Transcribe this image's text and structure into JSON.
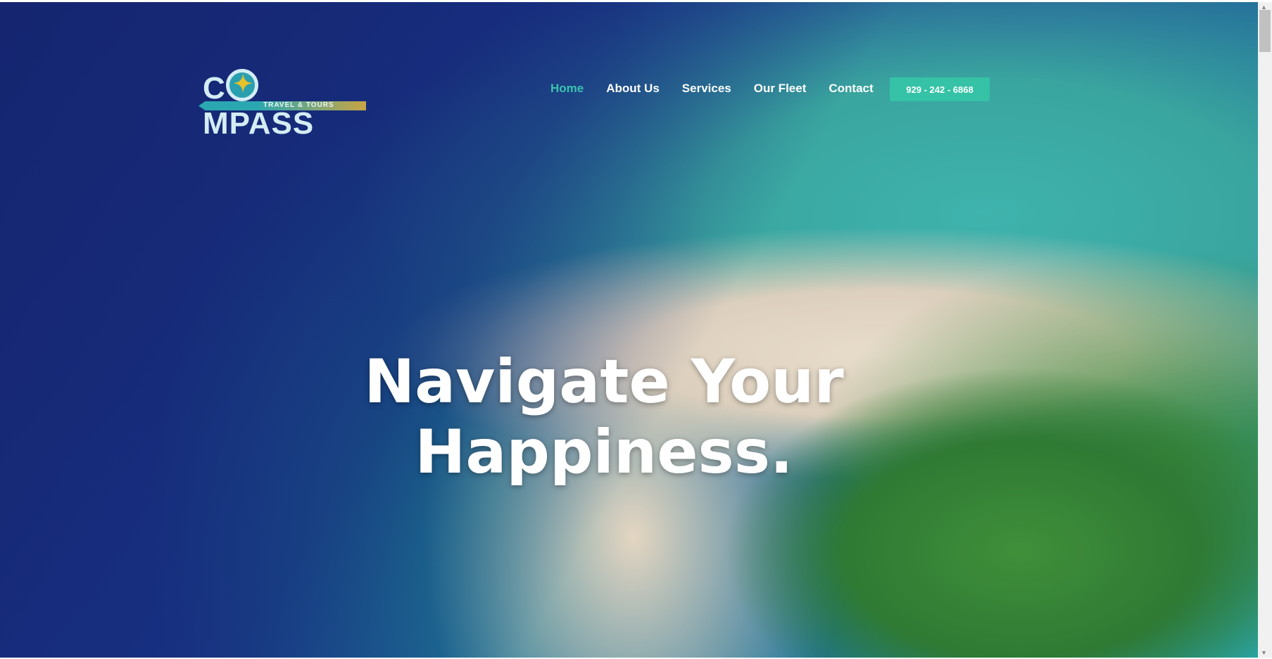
{
  "logo": {
    "word_pre": "C",
    "word_post": "MPASS",
    "tagline": "TRAVEL & TOURS"
  },
  "nav": [
    {
      "label": "Home",
      "active": true
    },
    {
      "label": "About Us"
    },
    {
      "label": "Services"
    },
    {
      "label": "Our Fleet"
    },
    {
      "label": "Contact"
    }
  ],
  "phone_button": "929 - 242 - 6868",
  "hero": {
    "line1": "Navigate Your",
    "line2": "Happiness."
  },
  "colors": {
    "accent": "#35c2a6",
    "nav_active": "#3cc3ae"
  }
}
